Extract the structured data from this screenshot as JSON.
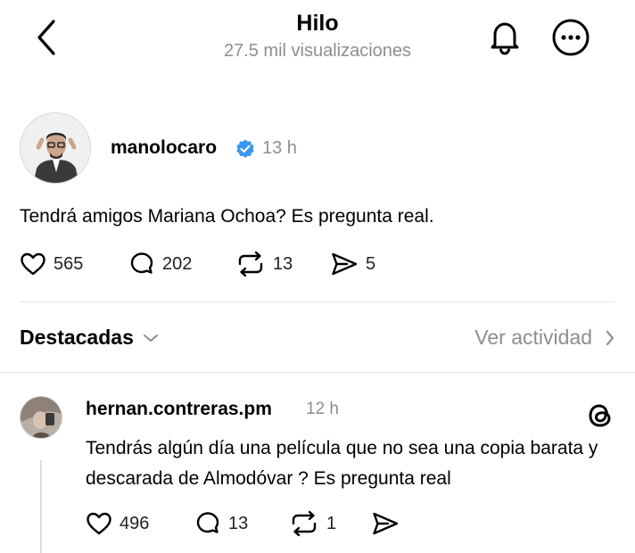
{
  "header": {
    "title": "Hilo",
    "subtitle": "27.5 mil visualizaciones"
  },
  "post": {
    "username": "manolocaro",
    "time": "13 h",
    "text": "Tendrá amigos Mariana Ochoa? Es pregunta real.",
    "likes": "565",
    "comments": "202",
    "reposts": "13",
    "shares": "5"
  },
  "section": {
    "title": "Destacadas",
    "link": "Ver actividad"
  },
  "reply": {
    "username": "hernan.contreras.pm",
    "time": "12 h",
    "text": "Tendrás algún día una película que no sea una copia barata y descarada de Almodóvar ? Es pregunta real",
    "likes": "496",
    "comments": "13",
    "reposts": "1"
  },
  "colors": {
    "verified_badge": "#3897f0",
    "muted_text": "#8e8e8e",
    "divider": "#e6e6e6"
  },
  "icons": [
    "back-chevron",
    "bell",
    "more-dots",
    "verified-badge",
    "heart",
    "comment-bubble",
    "repost",
    "send",
    "chevron-down",
    "chevron-right",
    "threads-logo"
  ]
}
